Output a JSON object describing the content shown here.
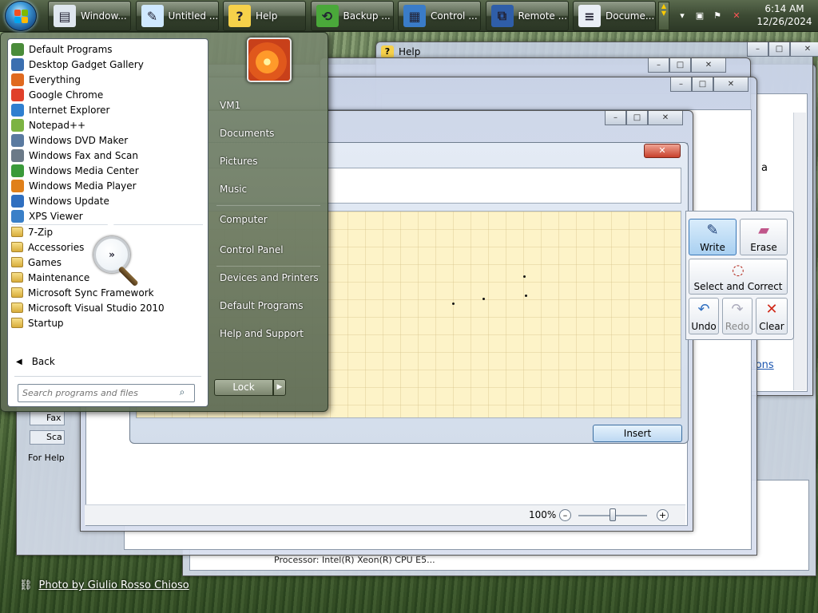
{
  "taskbar": {
    "buttons": [
      {
        "label": "Window...",
        "icon": "explorer-icon",
        "color": "#dfe7ef"
      },
      {
        "label": "Untitled ...",
        "icon": "paint-icon",
        "color": "#cfe8ff"
      },
      {
        "label": "Help",
        "icon": "help-icon",
        "color": "#f6d14a"
      },
      {
        "label": "Backup ...",
        "icon": "backup-icon",
        "color": "#4aa83a"
      },
      {
        "label": "Control ...",
        "icon": "control-panel-icon",
        "color": "#3a7cc8"
      },
      {
        "label": "Remote ...",
        "icon": "remote-desktop-icon",
        "color": "#2f5ea8"
      },
      {
        "label": "Docume...",
        "icon": "document-icon",
        "color": "#e9eef5"
      }
    ],
    "clock": {
      "time": "6:14 AM",
      "date": "12/26/2024"
    }
  },
  "windows": {
    "help_title": "Help"
  },
  "start_menu": {
    "pinned": [
      {
        "label": "Default Programs",
        "icon": "default-programs-icon",
        "color": "#4a8c3a"
      },
      {
        "label": "Desktop Gadget Gallery",
        "icon": "gadget-icon",
        "color": "#3b6fb0"
      },
      {
        "label": "Everything",
        "icon": "search-icon",
        "color": "#e06a20"
      },
      {
        "label": "Google Chrome",
        "icon": "chrome-icon",
        "color": "#e0402a"
      },
      {
        "label": "Internet Explorer",
        "icon": "ie-icon",
        "color": "#2f7fd0"
      },
      {
        "label": "Notepad++",
        "icon": "notepad-icon",
        "color": "#7cb342"
      },
      {
        "label": "Windows DVD Maker",
        "icon": "dvd-icon",
        "color": "#5a7aa0"
      },
      {
        "label": "Windows Fax and Scan",
        "icon": "fax-icon",
        "color": "#6b7a88"
      },
      {
        "label": "Windows Media Center",
        "icon": "media-center-icon",
        "color": "#3a9a3a"
      },
      {
        "label": "Windows Media Player",
        "icon": "media-player-icon",
        "color": "#e0801a"
      },
      {
        "label": "Windows Update",
        "icon": "update-icon",
        "color": "#2f6fc0"
      },
      {
        "label": "XPS Viewer",
        "icon": "xps-icon",
        "color": "#3a80c8"
      }
    ],
    "folders": [
      {
        "label": "7-Zip"
      },
      {
        "label": "Accessories"
      },
      {
        "label": "Games"
      },
      {
        "label": "Maintenance"
      },
      {
        "label": "Microsoft Sync Framework"
      },
      {
        "label": "Microsoft Visual Studio 2010"
      },
      {
        "label": "Startup"
      }
    ],
    "back_label": "Back",
    "search_placeholder": "Search programs and files",
    "right_links": [
      "VM1",
      "Documents",
      "Pictures",
      "Music",
      "Computer",
      "Control Panel",
      "Devices and Printers",
      "Default Programs",
      "Help and Support"
    ],
    "lock_label": "Lock"
  },
  "magnifier_text": "»",
  "input_panel": {
    "insert_label": "Insert",
    "tools": {
      "write": "Write",
      "erase": "Erase",
      "select": "Select and Correct",
      "undo": "Undo",
      "redo": "Redo",
      "clear": "Clear"
    }
  },
  "zoom": {
    "percent": "100%",
    "level": 0.5
  },
  "background_texts": {
    "fax": "Fax",
    "scan": "Sca",
    "for_help": "For Help",
    "letter_a": "a",
    "options": "tions",
    "processor": "Processor:  Intel(R) Xeon(R) CPU E5..."
  },
  "credit": "Photo by Giulio Rosso Chioso"
}
